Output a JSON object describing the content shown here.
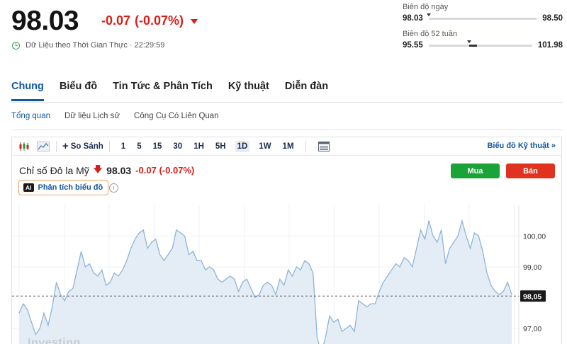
{
  "quote": {
    "price": "98.03",
    "change": "-0.07",
    "change_pct": "(-0.07%)",
    "realtime_label": "Dữ Liệu theo Thời Gian Thực · 22:29:59"
  },
  "ranges": {
    "day": {
      "label": "Biên độ ngày",
      "low": "98.03",
      "high": "98.50",
      "position": 0.0
    },
    "week52": {
      "label": "Biên độ 52 tuần",
      "low": "95.55",
      "high": "101.98",
      "position": 0.39
    }
  },
  "tabs": [
    {
      "label": "Chung",
      "active": true
    },
    {
      "label": "Biểu đồ",
      "active": false
    },
    {
      "label": "Tin Tức & Phân Tích",
      "active": false
    },
    {
      "label": "Kỹ thuật",
      "active": false
    },
    {
      "label": "Diễn đàn",
      "active": false
    }
  ],
  "subtabs": [
    {
      "label": "Tổng quan",
      "active": true
    },
    {
      "label": "Dữ liệu Lịch sử",
      "active": false
    },
    {
      "label": "Công Cụ Có Liên Quan",
      "active": false
    }
  ],
  "toolbar": {
    "compare_label": "So Sánh",
    "timeframes": [
      "1",
      "5",
      "15",
      "30",
      "1H",
      "5H",
      "1D",
      "1W",
      "1M"
    ],
    "active_timeframe": "1D",
    "technical_chart_label": "Biểu đồ Kỹ thuật »"
  },
  "chart_header": {
    "instrument": "Chỉ số Đô la Mỹ",
    "price": "98.03",
    "change": "-0.07 (-0.07%)",
    "ai_badge": "AI",
    "ai_label": "Phân tích biểu đồ",
    "info_glyph": "i",
    "buy_label": "Mua",
    "sell_label": "Bán"
  },
  "watermark": "Investing",
  "colors": {
    "accent": "#1256a0",
    "down": "#d91e18",
    "buy": "#1aa336",
    "sell": "#e0321f",
    "line": "#8fb4d6",
    "area": "#e4edf6"
  },
  "chart_data": {
    "type": "area",
    "title": "",
    "xlabel": "",
    "ylabel": "",
    "y_ticks": [
      "100,00",
      "99,00",
      "97,00"
    ],
    "y_tick_values": [
      100,
      99,
      97
    ],
    "last_price_label": "98,05",
    "last_price": 98.05,
    "ylim": [
      96.4,
      101.0
    ],
    "grid": true,
    "series": [
      {
        "values": [
          97.5,
          97.8,
          97.6,
          97.2,
          96.8,
          97.0,
          97.5,
          97.1,
          97.7,
          98.5,
          98.1,
          97.9,
          98.2,
          98.3,
          98.9,
          99.5,
          99.0,
          99.1,
          98.8,
          98.7,
          98.9,
          98.4,
          98.5,
          98.8,
          98.7,
          98.9,
          99.2,
          99.6,
          99.9,
          100.1,
          100.2,
          99.6,
          99.8,
          99.9,
          99.4,
          99.2,
          99.4,
          99.6,
          100.2,
          100.1,
          100.0,
          99.4,
          99.5,
          99.2,
          99.2,
          98.9,
          99.0,
          98.9,
          98.6,
          98.5,
          98.6,
          98.7,
          98.6,
          98.2,
          98.5,
          98.6,
          98.3,
          98.0,
          98.1,
          98.4,
          98.5,
          98.4,
          98.1,
          98.6,
          98.4,
          98.9,
          98.7,
          99.0,
          98.9,
          99.2,
          99.1,
          98.8,
          96.7,
          96.2,
          96.7,
          97.4,
          97.2,
          97.3,
          96.9,
          97.0,
          97.1,
          96.9,
          97.9,
          97.8,
          97.7,
          97.8,
          97.8,
          98.2,
          98.5,
          98.7,
          98.9,
          99.1,
          99.0,
          99.3,
          99.2,
          99.0,
          99.6,
          100.2,
          99.9,
          100.5,
          100.0,
          99.8,
          100.2,
          99.1,
          99.6,
          99.8,
          100.0,
          100.5,
          100.0,
          99.6,
          100.1,
          100.0,
          99.5,
          98.8,
          98.4,
          98.2,
          98.1,
          98.2,
          98.5,
          98.1
        ]
      }
    ]
  }
}
